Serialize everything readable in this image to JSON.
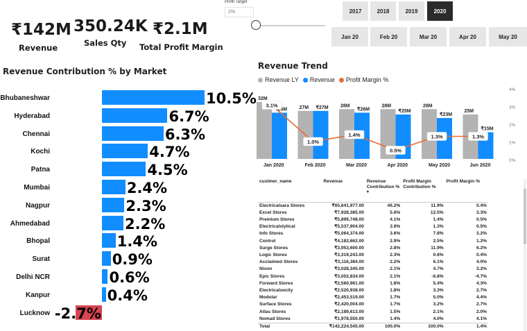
{
  "kpis": [
    {
      "value": "₹142M",
      "label": "Revenue"
    },
    {
      "value": "350.24K",
      "label": "Sales Qty"
    },
    {
      "value": "₹2.1M",
      "label": "Total Profit Margin"
    }
  ],
  "profit_target": {
    "title": "Profit Target",
    "placeholder": "2%"
  },
  "years": [
    "2017",
    "2018",
    "2019",
    "2020"
  ],
  "active_year": "2020",
  "months": [
    "Jan 20",
    "Feb 20",
    "Mar 20",
    "Apr 20",
    "May 20",
    "Jun 20"
  ],
  "markets_title": "Revenue Contribution % by Market",
  "trend_title": "Revenue Trend",
  "colors": {
    "positive": "#118DFF",
    "negative": "#D64550",
    "revenue_ly": "#B3B3B3",
    "margin_line": "#E66C37",
    "active": "#2B2B2B"
  },
  "chart_data": [
    {
      "type": "bar",
      "orientation": "horizontal",
      "title": "Revenue Contribution % by Market",
      "categories": [
        "Bhubaneshwar",
        "Hyderabad",
        "Chennai",
        "Kochi",
        "Patna",
        "Mumbai",
        "Nagpur",
        "Ahmedabad",
        "Bhopal",
        "Surat",
        "Delhi NCR",
        "Kanpur",
        "Lucknow"
      ],
      "values": [
        10.5,
        6.7,
        6.3,
        4.7,
        4.5,
        2.4,
        2.3,
        2.2,
        1.4,
        0.9,
        0.6,
        0.4,
        -2.7
      ],
      "labels": [
        "10.5%",
        "6.7%",
        "6.3%",
        "4.7%",
        "4.5%",
        "2.4%",
        "2.3%",
        "2.2%",
        "1.4%",
        "0.9%",
        "0.6%",
        "0.4%",
        "-2.7%"
      ],
      "unit": "%"
    },
    {
      "type": "bar",
      "title": "Revenue Trend",
      "categories": [
        "Jan 2020",
        "Feb 2020",
        "Mar 2020",
        "Apr 2020",
        "May 2020",
        "Jun 2020"
      ],
      "series": [
        {
          "name": "Revenue LY",
          "values": [
            32,
            27,
            28,
            28,
            28,
            25
          ],
          "labels": [
            "32M",
            "27M",
            "28M",
            "28M",
            "28M",
            "25M"
          ]
        },
        {
          "name": "Revenue",
          "values": [
            26,
            27,
            26,
            25,
            23,
            15
          ],
          "labels": [
            "₹26M",
            "₹27M",
            "₹26M",
            "₹25M",
            "₹23M",
            "₹15M"
          ]
        },
        {
          "name": "Profit Margin %",
          "type": "line",
          "values": [
            3.1,
            1.0,
            1.4,
            0.5,
            1.3,
            1.3
          ],
          "labels": [
            "3.1%",
            "1.0%",
            "1.4%",
            "0.5%",
            "1.3%",
            "1.3%"
          ],
          "axis": "right"
        }
      ],
      "ylim": [
        0,
        32
      ],
      "y2lim": [
        0,
        4
      ],
      "y2_ticks": [
        "4%",
        "3%",
        "2%",
        "1%",
        "0%"
      ],
      "legend": "top-left"
    }
  ],
  "table": {
    "headers": [
      "custmer_name",
      "Revenue",
      "Revenue Contribution %",
      "Profit Margin Contribution %",
      "Profit Margin %"
    ],
    "rows": [
      [
        "Electricalsara Stores",
        "₹65,641,977.00",
        "46.2%",
        "11.9%",
        "0.4%"
      ],
      [
        "Excel Stores",
        "₹7,928,385.00",
        "5.6%",
        "12.5%",
        "3.3%"
      ],
      [
        "Premium Stores",
        "₹5,899,748.00",
        "4.1%",
        "1.4%",
        "0.5%"
      ],
      [
        "Electricalslytical",
        "₹5,537,904.00",
        "3.9%",
        "1.3%",
        "0.5%"
      ],
      [
        "Info Stores",
        "₹5,064,374.00",
        "3.6%",
        "7.8%",
        "3.2%"
      ],
      [
        "Control",
        "₹4,182,662.00",
        "2.9%",
        "2.5%",
        "1.2%"
      ],
      [
        "Surge Stores",
        "₹3,953,600.00",
        "2.8%",
        "11.9%",
        "6.2%"
      ],
      [
        "Logic Stores",
        "₹3,319,243.00",
        "2.3%",
        "0.6%",
        "0.4%"
      ],
      [
        "Acclaimed Stores",
        "₹3,116,384.00",
        "2.2%",
        "6.1%",
        "4.0%"
      ],
      [
        "Nixon",
        "₹3,028,345.00",
        "2.1%",
        "4.7%",
        "3.2%"
      ],
      [
        "Epic Stores",
        "₹3,002,834.00",
        "2.1%",
        "-6.8%",
        "-4.7%"
      ],
      [
        "Forward Stores",
        "₹2,560,961.00",
        "1.8%",
        "5.4%",
        "4.3%"
      ],
      [
        "Electricalsocity",
        "₹2,520,938.00",
        "1.8%",
        "3.3%",
        "2.7%"
      ],
      [
        "Modular",
        "₹2,453,519.00",
        "1.7%",
        "5.0%",
        "4.4%"
      ],
      [
        "Surface Stores",
        "₹2,420,004.00",
        "1.7%",
        "3.2%",
        "2.7%"
      ],
      [
        "Atlas Stores",
        "₹2,189,613.00",
        "1.5%",
        "2.1%",
        "2.0%"
      ],
      [
        "Nomad Stores",
        "₹1,978,550.00",
        "1.4%",
        "4.0%",
        "4.1%"
      ]
    ],
    "total": [
      "Total",
      "₹142,224,545.00",
      "100.0%",
      "100.0%",
      "1.4%"
    ]
  }
}
